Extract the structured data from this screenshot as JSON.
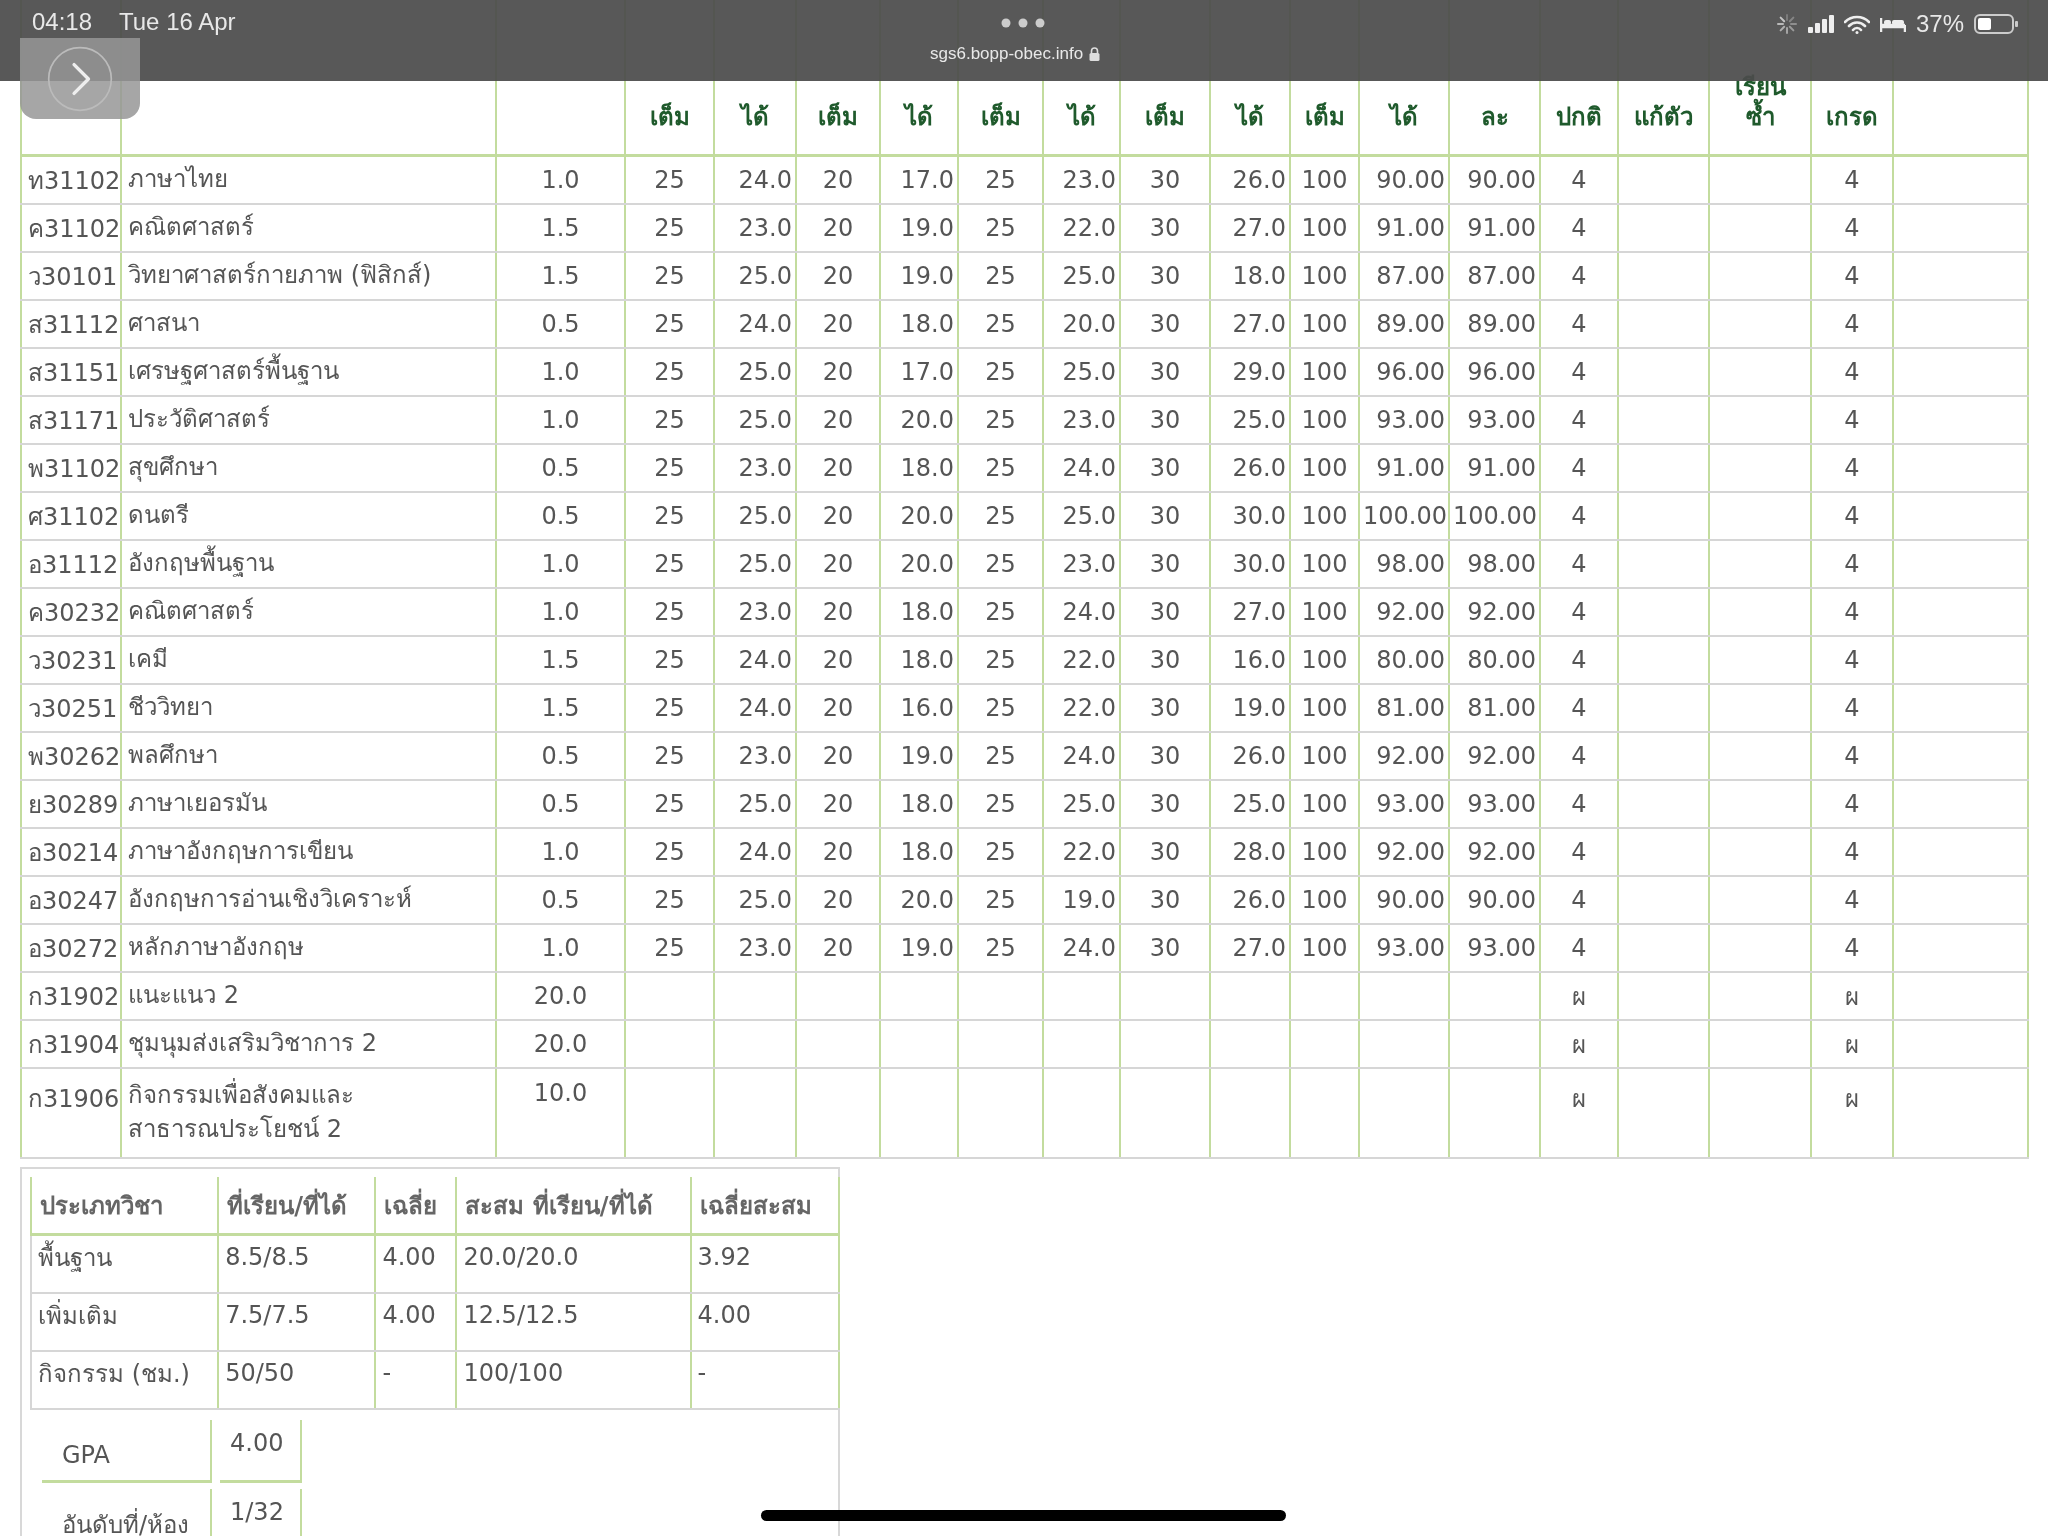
{
  "status_bar": {
    "time": "04:18",
    "date": "Tue 16 Apr",
    "url": "sgs6.bopp-obec.info",
    "battery": "37%"
  },
  "grades": {
    "columns": [
      "เต็ม",
      "ได้",
      "เต็ม",
      "ได้",
      "เต็ม",
      "ได้",
      "เต็ม",
      "ได้",
      "เต็ม",
      "ได้",
      "ละ",
      "ปกติ",
      "แก้ตัว",
      "เรียน ซ้ำ",
      "เกรด"
    ],
    "rows": [
      {
        "code": "ท31102",
        "name": "ภาษาไทย",
        "credit": "1.0",
        "scores": [
          "25",
          "24.0",
          "20",
          "17.0",
          "25",
          "23.0",
          "30",
          "26.0",
          "100",
          "90.00"
        ],
        "percent": "90.00",
        "normal": "4",
        "grade": "4"
      },
      {
        "code": "ค31102",
        "name": "คณิตศาสตร์",
        "credit": "1.5",
        "scores": [
          "25",
          "23.0",
          "20",
          "19.0",
          "25",
          "22.0",
          "30",
          "27.0",
          "100",
          "91.00"
        ],
        "percent": "91.00",
        "normal": "4",
        "grade": "4"
      },
      {
        "code": "ว30101",
        "name": "วิทยาศาสตร์กายภาพ (ฟิสิกส์)",
        "credit": "1.5",
        "scores": [
          "25",
          "25.0",
          "20",
          "19.0",
          "25",
          "25.0",
          "30",
          "18.0",
          "100",
          "87.00"
        ],
        "percent": "87.00",
        "normal": "4",
        "grade": "4"
      },
      {
        "code": "ส31112",
        "name": "ศาสนา",
        "credit": "0.5",
        "scores": [
          "25",
          "24.0",
          "20",
          "18.0",
          "25",
          "20.0",
          "30",
          "27.0",
          "100",
          "89.00"
        ],
        "percent": "89.00",
        "normal": "4",
        "grade": "4"
      },
      {
        "code": "ส31151",
        "name": "เศรษฐศาสตร์พื้นฐาน",
        "credit": "1.0",
        "scores": [
          "25",
          "25.0",
          "20",
          "17.0",
          "25",
          "25.0",
          "30",
          "29.0",
          "100",
          "96.00"
        ],
        "percent": "96.00",
        "normal": "4",
        "grade": "4"
      },
      {
        "code": "ส31171",
        "name": "ประวัติศาสตร์",
        "credit": "1.0",
        "scores": [
          "25",
          "25.0",
          "20",
          "20.0",
          "25",
          "23.0",
          "30",
          "25.0",
          "100",
          "93.00"
        ],
        "percent": "93.00",
        "normal": "4",
        "grade": "4"
      },
      {
        "code": "พ31102",
        "name": "สุขศึกษา",
        "credit": "0.5",
        "scores": [
          "25",
          "23.0",
          "20",
          "18.0",
          "25",
          "24.0",
          "30",
          "26.0",
          "100",
          "91.00"
        ],
        "percent": "91.00",
        "normal": "4",
        "grade": "4"
      },
      {
        "code": "ศ31102",
        "name": "ดนตรี",
        "credit": "0.5",
        "scores": [
          "25",
          "25.0",
          "20",
          "20.0",
          "25",
          "25.0",
          "30",
          "30.0",
          "100",
          "100.00"
        ],
        "percent": "100.00",
        "normal": "4",
        "grade": "4"
      },
      {
        "code": "อ31112",
        "name": "อังกฤษพื้นฐาน",
        "credit": "1.0",
        "scores": [
          "25",
          "25.0",
          "20",
          "20.0",
          "25",
          "23.0",
          "30",
          "30.0",
          "100",
          "98.00"
        ],
        "percent": "98.00",
        "normal": "4",
        "grade": "4"
      },
      {
        "code": "ค30232",
        "name": "คณิตศาสตร์",
        "credit": "1.0",
        "scores": [
          "25",
          "23.0",
          "20",
          "18.0",
          "25",
          "24.0",
          "30",
          "27.0",
          "100",
          "92.00"
        ],
        "percent": "92.00",
        "normal": "4",
        "grade": "4"
      },
      {
        "code": "ว30231",
        "name": "เคมี",
        "credit": "1.5",
        "scores": [
          "25",
          "24.0",
          "20",
          "18.0",
          "25",
          "22.0",
          "30",
          "16.0",
          "100",
          "80.00"
        ],
        "percent": "80.00",
        "normal": "4",
        "grade": "4"
      },
      {
        "code": "ว30251",
        "name": "ชีววิทยา",
        "credit": "1.5",
        "scores": [
          "25",
          "24.0",
          "20",
          "16.0",
          "25",
          "22.0",
          "30",
          "19.0",
          "100",
          "81.00"
        ],
        "percent": "81.00",
        "normal": "4",
        "grade": "4"
      },
      {
        "code": "พ30262",
        "name": "พลศึกษา",
        "credit": "0.5",
        "scores": [
          "25",
          "23.0",
          "20",
          "19.0",
          "25",
          "24.0",
          "30",
          "26.0",
          "100",
          "92.00"
        ],
        "percent": "92.00",
        "normal": "4",
        "grade": "4"
      },
      {
        "code": "ย30289",
        "name": "ภาษาเยอรมัน",
        "credit": "0.5",
        "scores": [
          "25",
          "25.0",
          "20",
          "18.0",
          "25",
          "25.0",
          "30",
          "25.0",
          "100",
          "93.00"
        ],
        "percent": "93.00",
        "normal": "4",
        "grade": "4"
      },
      {
        "code": "อ30214",
        "name": "ภาษาอังกฤษการเขียน",
        "credit": "1.0",
        "scores": [
          "25",
          "24.0",
          "20",
          "18.0",
          "25",
          "22.0",
          "30",
          "28.0",
          "100",
          "92.00"
        ],
        "percent": "92.00",
        "normal": "4",
        "grade": "4"
      },
      {
        "code": "อ30247",
        "name": "อังกฤษการอ่านเชิงวิเคราะห์",
        "credit": "0.5",
        "scores": [
          "25",
          "25.0",
          "20",
          "20.0",
          "25",
          "19.0",
          "30",
          "26.0",
          "100",
          "90.00"
        ],
        "percent": "90.00",
        "normal": "4",
        "grade": "4"
      },
      {
        "code": "อ30272",
        "name": "หลักภาษาอังกฤษ",
        "credit": "1.0",
        "scores": [
          "25",
          "23.0",
          "20",
          "19.0",
          "25",
          "24.0",
          "30",
          "27.0",
          "100",
          "93.00"
        ],
        "percent": "93.00",
        "normal": "4",
        "grade": "4"
      },
      {
        "code": "ก31902",
        "name": "แนะแนว 2",
        "credit": "20.0",
        "normal": "ผ",
        "grade": "ผ"
      },
      {
        "code": "ก31904",
        "name": "ชุมนุมส่งเสริมวิชาการ 2",
        "credit": "20.0",
        "normal": "ผ",
        "grade": "ผ"
      },
      {
        "code": "ก31906",
        "name": "กิจกรรมเพื่อสังคมและ สาธารณประโยชน์ 2",
        "credit": "10.0",
        "normal": "ผ",
        "grade": "ผ"
      }
    ]
  },
  "summary": {
    "columns": [
      "ประเภทวิชา",
      "ที่เรียน/ที่ได้",
      "เฉลี่ย",
      "สะสม ที่เรียน/ที่ได้",
      "เฉลี่ยสะสม"
    ],
    "rows": [
      [
        "พื้นฐาน",
        "8.5/8.5",
        "4.00",
        "20.0/20.0",
        "3.92"
      ],
      [
        "เพิ่มเติม",
        "7.5/7.5",
        "4.00",
        "12.5/12.5",
        "4.00"
      ],
      [
        "กิจกรรม (ชม.)",
        "50/50",
        "-",
        "100/100",
        "-"
      ]
    ],
    "results": [
      {
        "label": "GPA",
        "value": "4.00"
      },
      {
        "label": "อันดับที่/ห้อง",
        "value": "1/32"
      }
    ]
  }
}
